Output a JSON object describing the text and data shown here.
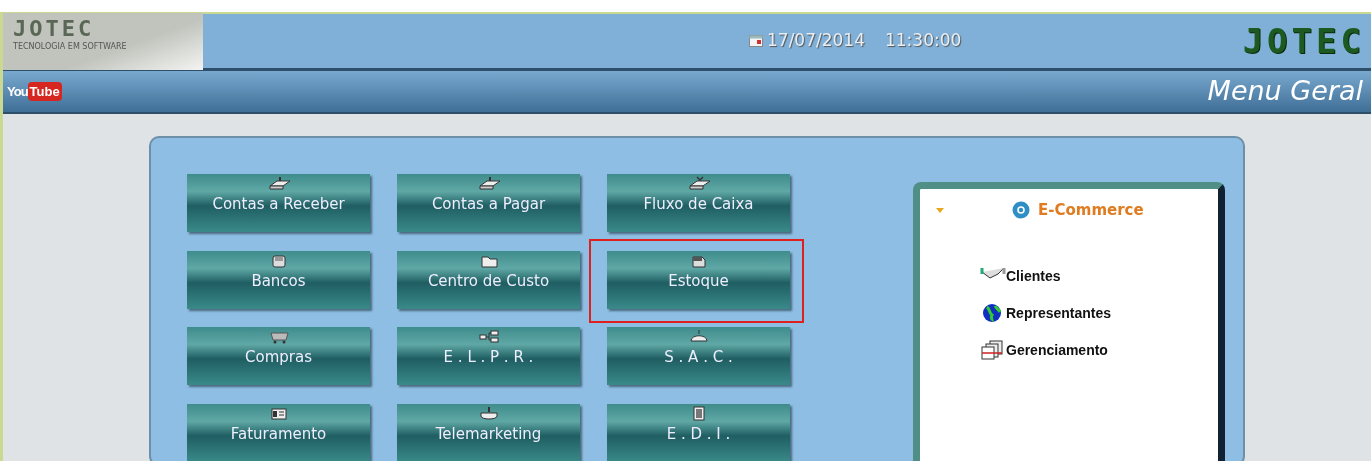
{
  "header": {
    "logo_text": "JOTEC",
    "logo_tagline": "TECNOLOGIA EM SOFTWARE",
    "date": "17/07/2014",
    "time": "11:30:00",
    "brand_text": "JOTEC"
  },
  "subheader": {
    "youtube_you": "You",
    "youtube_tube": "Tube",
    "title": "Menu Geral"
  },
  "tiles": [
    {
      "label": "Contas a Receber",
      "highlighted": false
    },
    {
      "label": "Contas a Pagar",
      "highlighted": false
    },
    {
      "label": "Fluxo de Caixa",
      "highlighted": false
    },
    {
      "label": "Bancos",
      "highlighted": false
    },
    {
      "label": "Centro de Custo",
      "highlighted": false
    },
    {
      "label": "Estoque",
      "highlighted": true
    },
    {
      "label": "Compras",
      "highlighted": false
    },
    {
      "label": "E . L . P . R .",
      "highlighted": false
    },
    {
      "label": "S . A . C .",
      "highlighted": false
    },
    {
      "label": "Faturamento",
      "highlighted": false
    },
    {
      "label": "Telemarketing",
      "highlighted": false
    },
    {
      "label": "E . D . I .",
      "highlighted": false
    }
  ],
  "ecommerce": {
    "title": "E-Commerce",
    "expanded": true,
    "items": [
      {
        "label": "Clientes"
      },
      {
        "label": "Representantes"
      },
      {
        "label": "Gerenciamento"
      }
    ]
  }
}
